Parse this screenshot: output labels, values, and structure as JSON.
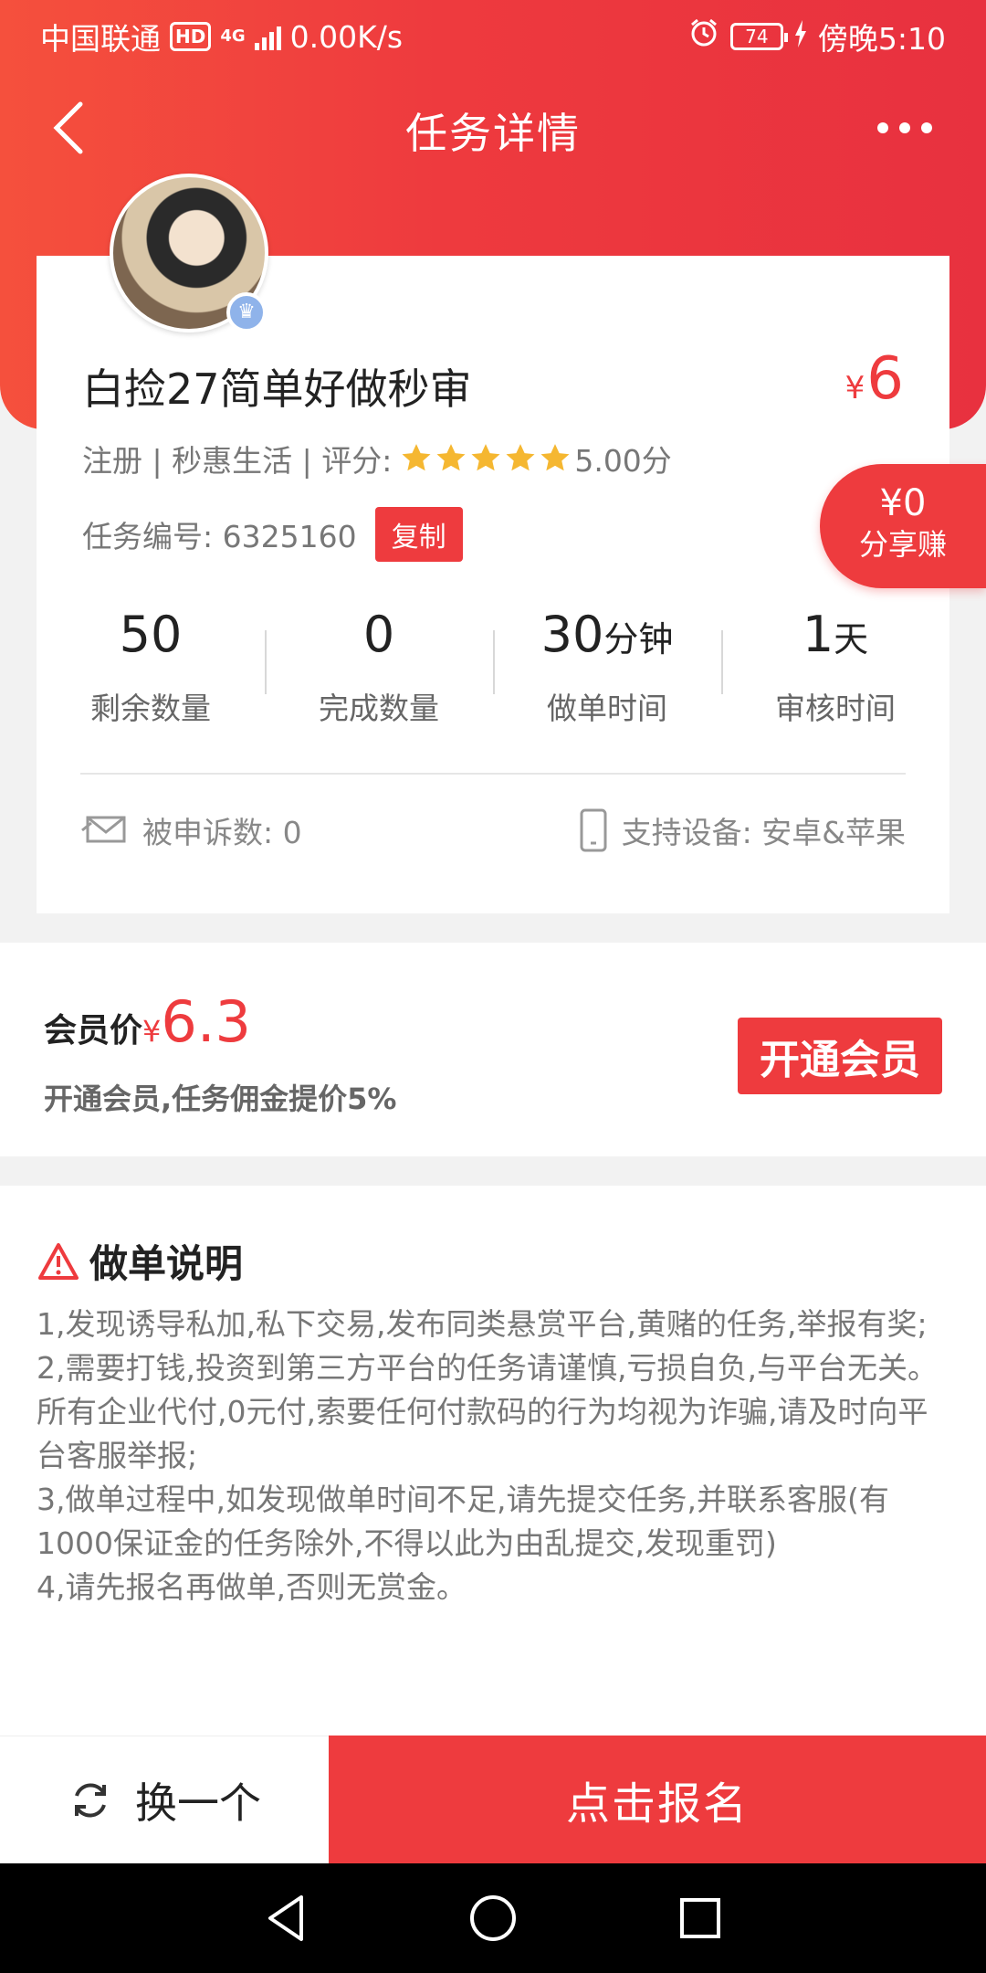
{
  "status_bar": {
    "carrier": "中国联通",
    "hd": "HD",
    "network": "4G",
    "speed": "0.00K/s",
    "battery": "74",
    "time": "傍晚5:10"
  },
  "nav": {
    "title": "任务详情"
  },
  "task": {
    "title": "白捡27简单好做秒审",
    "price_symbol": "¥",
    "price": "6",
    "meta_prefix": "注册 | 秒惠生活 | 评分:",
    "rating": 5,
    "rating_text": "5.00分",
    "task_no_label": "任务编号:",
    "task_no": "6325160",
    "copy_label": "复制"
  },
  "share": {
    "amount": "¥0",
    "label": "分享赚"
  },
  "stats": [
    {
      "value": "50",
      "unit": "",
      "label": "剩余数量"
    },
    {
      "value": "0",
      "unit": "",
      "label": "完成数量"
    },
    {
      "value": "30",
      "unit": "分钟",
      "label": "做单时间"
    },
    {
      "value": "1",
      "unit": "天",
      "label": "审核时间"
    }
  ],
  "info": {
    "complaints": "被申诉数: 0",
    "devices": "支持设备: 安卓&苹果"
  },
  "member": {
    "label": "会员价",
    "symbol": "¥",
    "price": "6.3",
    "desc": "开通会员,任务佣金提价5%",
    "button": "开通会员"
  },
  "instructions": {
    "title": "做单说明",
    "lines": [
      "1,发现诱导私加,私下交易,发布同类悬赏平台,黄赌的任务,举报有奖;",
      "2,需要打钱,投资到第三方平台的任务请谨慎,亏损自负,与平台无关。所有企业代付,0元付,索要任何付款码的行为均视为诈骗,请及时向平台客服举报;",
      "3,做单过程中,如发现做单时间不足,请先提交任务,并联系客服(有1000保证金的任务除外,不得以此为由乱提交,发现重罚)",
      "4,请先报名再做单,否则无赏金。"
    ]
  },
  "actions": {
    "swap": "换一个",
    "signup": "点击报名"
  },
  "colors": {
    "accent": "#ee3b3e",
    "star": "#f5b731"
  }
}
